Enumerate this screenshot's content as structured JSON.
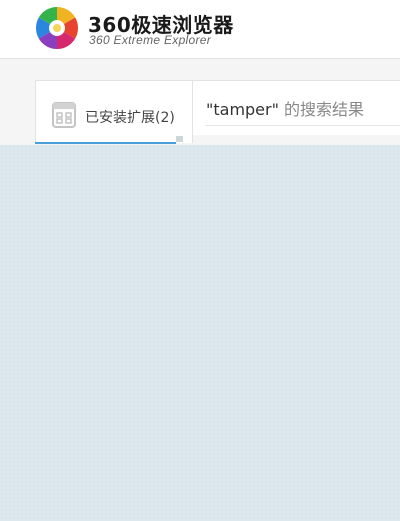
{
  "header": {
    "brand_title": "360极速浏览器",
    "brand_subtitle": "360 Extreme Explorer",
    "logo_icon": "360-browser-logo-icon"
  },
  "tabs": [
    {
      "label": "已安装扩展(2)",
      "icon": "store-icon",
      "active": true
    }
  ],
  "search": {
    "query": "\"tamper\"",
    "suffix": " 的搜索结果"
  },
  "colors": {
    "background": "#dde8ee",
    "accent": "#4a9fdb",
    "header_bg": "#ffffff"
  }
}
